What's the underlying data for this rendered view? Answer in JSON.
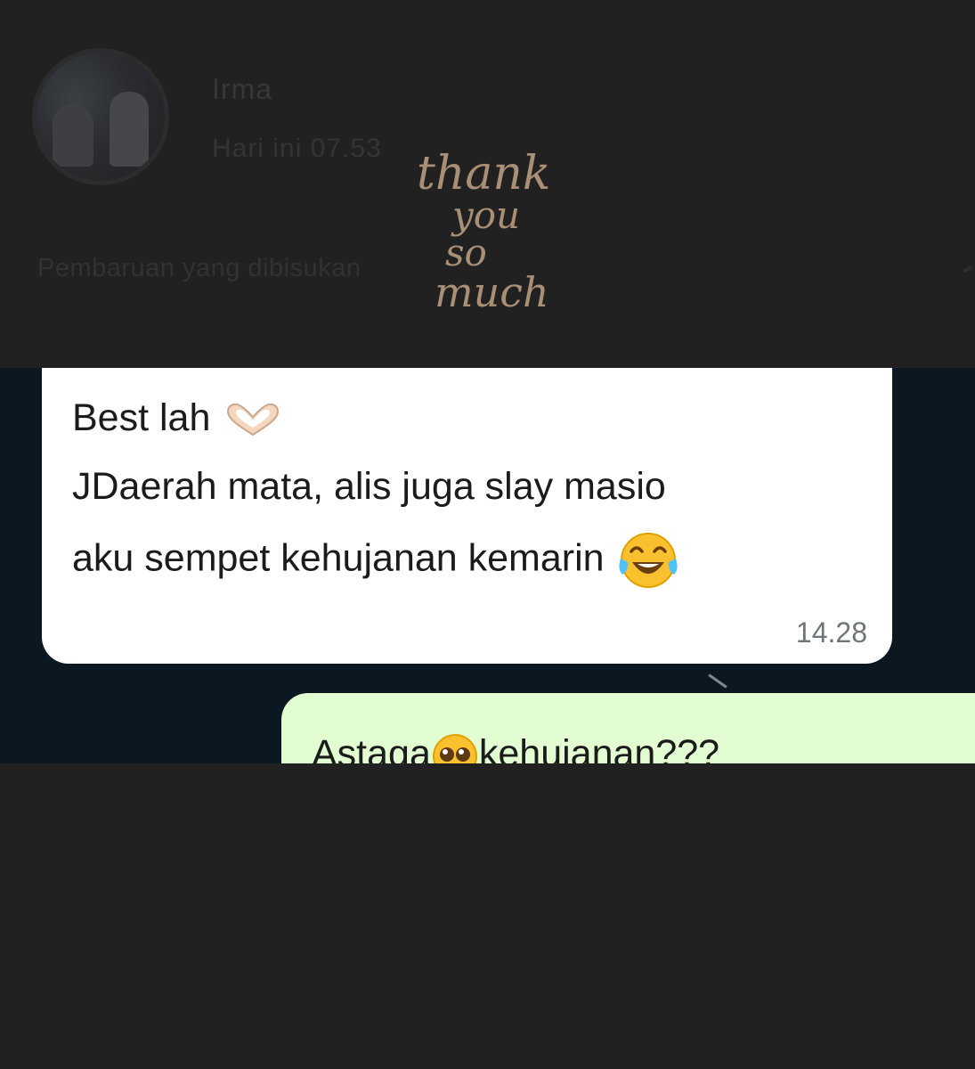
{
  "status": {
    "contact_name": "Irma",
    "time": "Hari ini 07.53",
    "muted_section": "Pembaruan yang dibisukan"
  },
  "watermark": {
    "lines": [
      "thank",
      "you",
      "so",
      "much"
    ]
  },
  "chat": {
    "incoming": {
      "line1": "Best lah",
      "line2": "JDaerah mata, alis juga slay masio",
      "line3": "aku sempet kehujanan kemarin",
      "time": "14.28"
    },
    "outgoing": {
      "text_before": "Astaga",
      "text_after": "kehujanan???"
    }
  },
  "icons": {
    "heart_hands": "heart-hands-icon",
    "laughing": "tears-of-joy-icon",
    "pleading": "pleading-face-icon"
  },
  "colors": {
    "background": "#212121",
    "chat_background": "#0c1821",
    "incoming_bubble": "#ffffff",
    "outgoing_bubble": "#e2fdd1",
    "watermark": "#a88f76"
  }
}
